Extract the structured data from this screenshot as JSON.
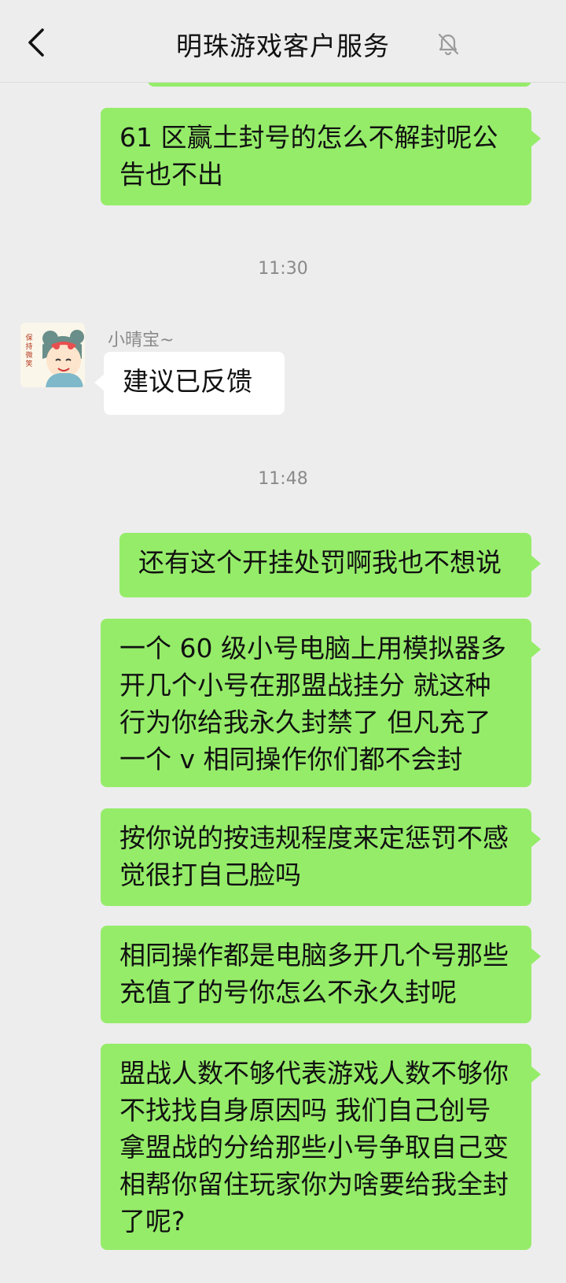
{
  "header": {
    "title": "明珠游戏客户服务",
    "back_icon": "chevron-left-icon",
    "mute_icon": "bell-muted-icon"
  },
  "messages": [
    {
      "type": "outgoing",
      "text": "61 区赢土封号的怎么不解封呢公告也不出"
    },
    {
      "type": "timestamp",
      "text": "11:30"
    },
    {
      "type": "incoming",
      "sender": "小晴宝~",
      "avatar_text": "保持微笑",
      "text": "建议已反馈"
    },
    {
      "type": "timestamp",
      "text": "11:48"
    },
    {
      "type": "outgoing",
      "text": "还有这个开挂处罚啊我也不想说"
    },
    {
      "type": "outgoing",
      "text": "一个 60 级小号电脑上用模拟器多开几个小号在那盟战挂分 就这种行为你给我永久封禁了 但凡充了一个 v 相同操作你们都不会封"
    },
    {
      "type": "outgoing",
      "text": "按你说的按违规程度来定惩罚不感觉很打自己脸吗"
    },
    {
      "type": "outgoing",
      "text": "相同操作都是电脑多开几个号那些充值了的号你怎么不永久封呢"
    },
    {
      "type": "outgoing",
      "text": "盟战人数不够代表游戏人数不够你不找找自身原因吗 我们自己创号拿盟战的分给那些小号争取自己变相帮你留住玩家你为啥要给我全封了呢?"
    }
  ],
  "colors": {
    "background": "#ededed",
    "outgoing_bubble": "#95ec69",
    "incoming_bubble": "#ffffff"
  }
}
